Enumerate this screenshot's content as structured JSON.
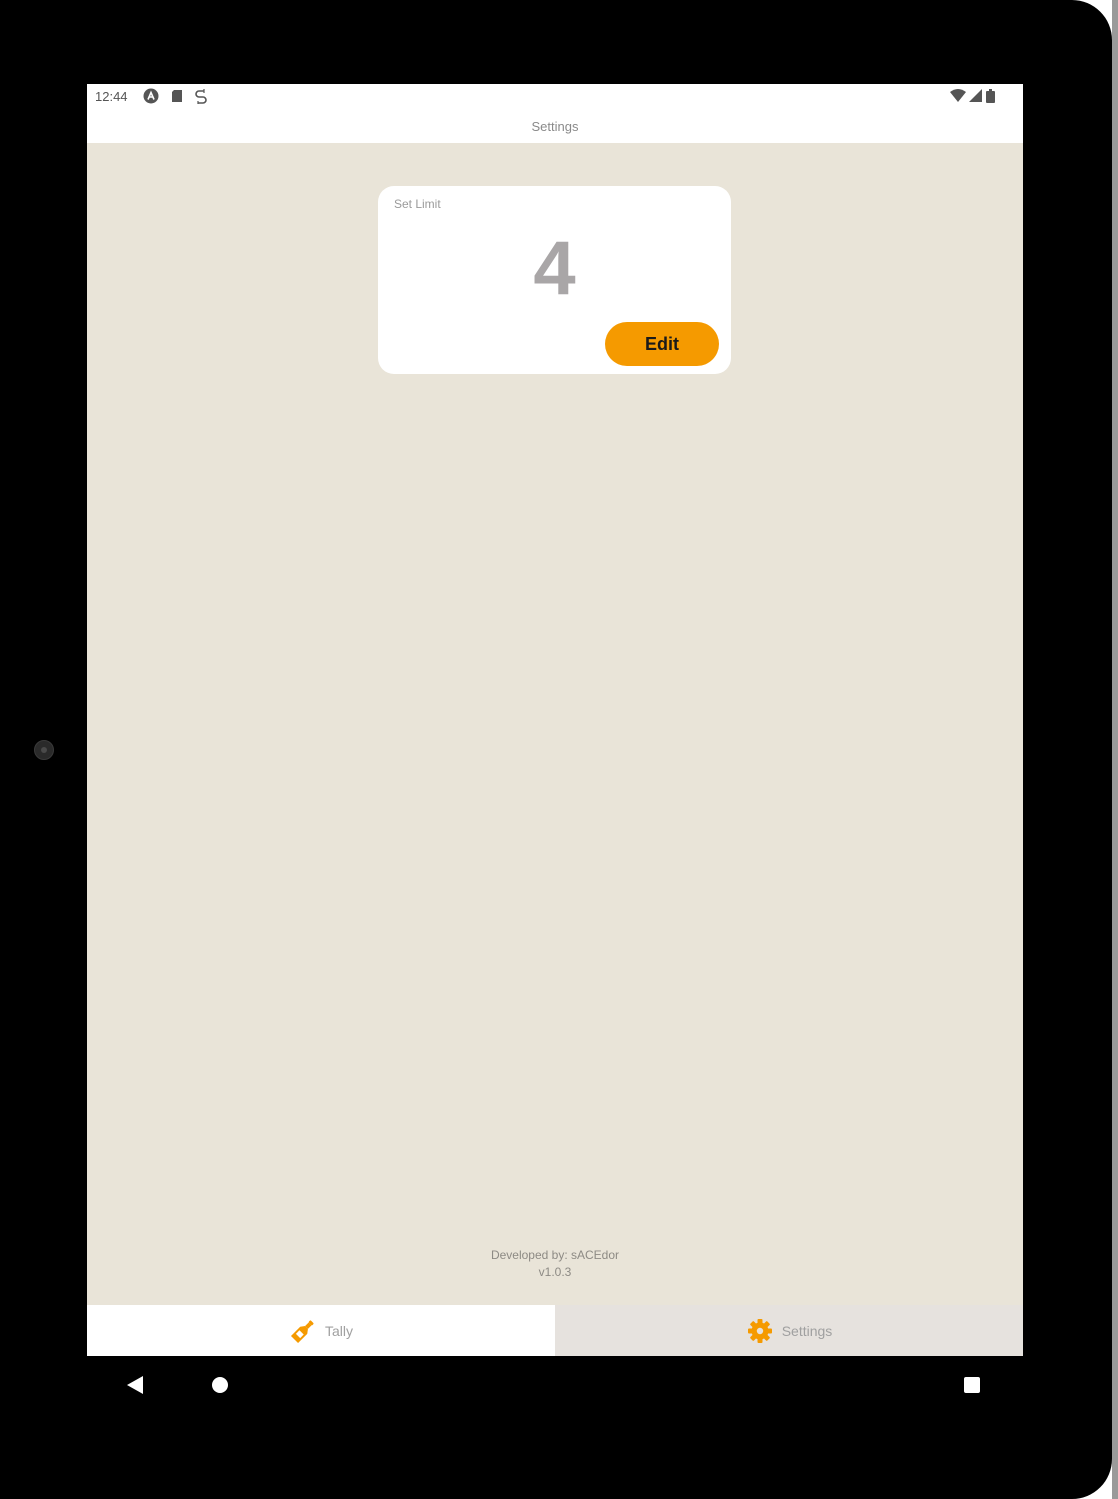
{
  "status_bar": {
    "time": "12:44",
    "icons_left": [
      "app-a-icon",
      "sd-card-icon",
      "sync-icon"
    ],
    "icons_right": [
      "wifi-icon",
      "signal-icon",
      "battery-icon"
    ]
  },
  "header": {
    "title": "Settings"
  },
  "limit_card": {
    "label": "Set Limit",
    "value": "4",
    "edit_label": "Edit"
  },
  "credits": {
    "developer": "Developed by: sACEdor",
    "version": "v1.0.3"
  },
  "tabs": [
    {
      "label": "Tally",
      "icon": "bottle-icon",
      "selected": false
    },
    {
      "label": "Settings",
      "icon": "gear-icon",
      "selected": true
    }
  ],
  "colors": {
    "accent": "#f59a00",
    "background": "#e9e4d8",
    "card": "#ffffff",
    "selected_tab": "#e6e2de"
  },
  "nav_bar": {
    "buttons": [
      "back-icon",
      "home-icon",
      "recents-icon"
    ]
  }
}
